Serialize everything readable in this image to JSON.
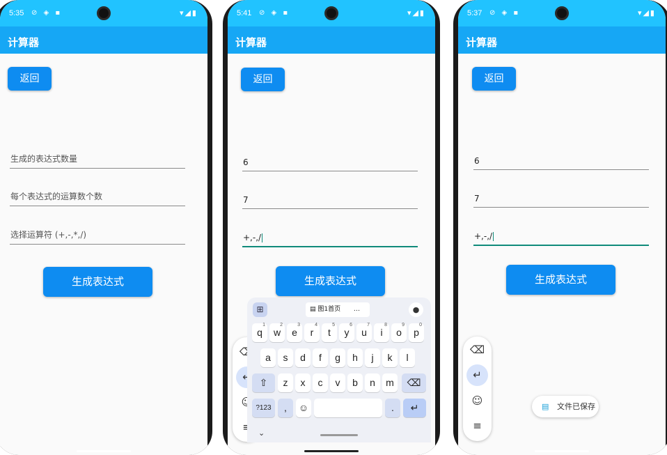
{
  "app_title": "计算器",
  "back_label": "返回",
  "generate_label": "生成表达式",
  "status_icons": "⊘ ◈ ▪",
  "status_right": "▾◢▮",
  "screens": [
    {
      "time": "5:35",
      "fields": [
        {
          "placeholder": "生成的表达式数量",
          "value": ""
        },
        {
          "placeholder": "每个表达式的运算数个数",
          "value": ""
        },
        {
          "placeholder": "选择运算符 (+,-,*,/)",
          "value": ""
        }
      ]
    },
    {
      "time": "5:41",
      "fields": [
        {
          "placeholder": "",
          "value": "6"
        },
        {
          "placeholder": "",
          "value": "7"
        },
        {
          "placeholder": "",
          "value": "+,-,/"
        }
      ]
    },
    {
      "time": "5:37",
      "fields": [
        {
          "placeholder": "",
          "value": "6"
        },
        {
          "placeholder": "",
          "value": "7"
        },
        {
          "placeholder": "",
          "value": "+,-,/"
        }
      ]
    }
  ],
  "keyboard": {
    "clipboard_text": "图1首页",
    "clipboard_more": "…",
    "row1": [
      "q",
      "w",
      "e",
      "r",
      "t",
      "y",
      "u",
      "i",
      "o",
      "p"
    ],
    "row1_hints": [
      "1",
      "2",
      "3",
      "4",
      "5",
      "6",
      "7",
      "8",
      "9",
      "0"
    ],
    "row2": [
      "a",
      "s",
      "d",
      "f",
      "g",
      "h",
      "j",
      "k",
      "l"
    ],
    "row3": [
      "z",
      "x",
      "c",
      "v",
      "b",
      "n",
      "m"
    ],
    "symbols_label": "?123",
    "comma": ",",
    "period": "."
  },
  "toast_text": "文件已保存"
}
